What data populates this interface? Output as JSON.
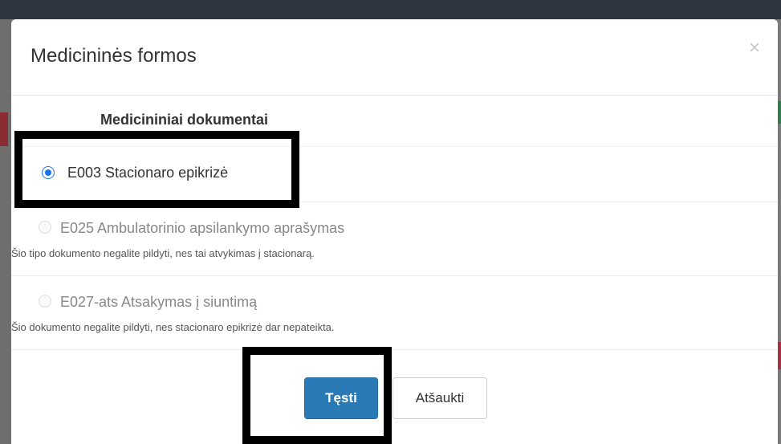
{
  "modal": {
    "title": "Medicininės formos",
    "close_symbol": "×"
  },
  "section": {
    "title": "Medicininiai dokumentai"
  },
  "options": [
    {
      "label": "E003 Stacionaro epikrizė",
      "selected": true,
      "enabled": true,
      "note": ""
    },
    {
      "label": "E025 Ambulatorinio apsilankymo aprašymas",
      "selected": false,
      "enabled": false,
      "note": "Šio tipo dokumento negalite pildyti, nes tai atvykimas į stacionarą."
    },
    {
      "label": "E027-ats Atsakymas į siuntimą",
      "selected": false,
      "enabled": false,
      "note": "Šio dokumento negalite pildyti, nes stacionaro epikrizė dar nepateikta."
    }
  ],
  "footer": {
    "continue_label": "Tęsti",
    "cancel_label": "Atšaukti"
  },
  "colors": {
    "primary": "#2a7ab6",
    "radio_selected": "#1a73e8",
    "highlight": "#000000"
  }
}
